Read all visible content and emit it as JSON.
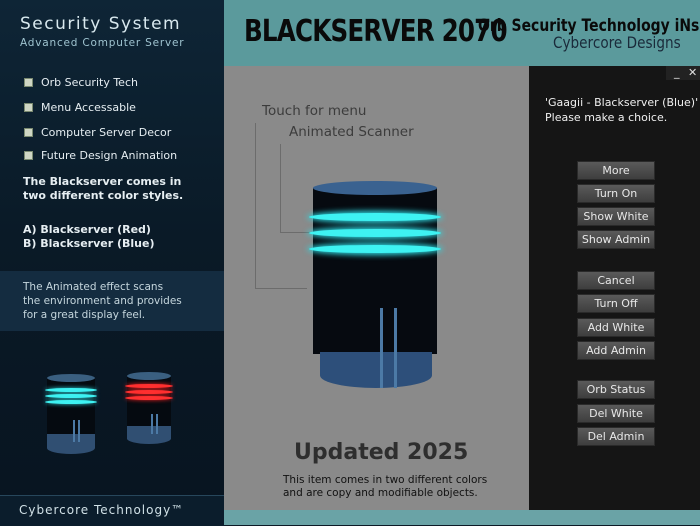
{
  "sidebar": {
    "title": "Security System",
    "subtitle": "Advanced Computer Server",
    "features": [
      "Orb Security Tech",
      "Menu Accessable",
      "Computer Server Decor",
      "Future Design Animation"
    ],
    "styles_intro_line1": "The Blackserver comes in",
    "styles_intro_line2": "two different color styles.",
    "style_a": "A) Blackserver  (Red)",
    "style_b": "B) Blackserver  (Blue)",
    "effect_line1": "The Animated effect scans",
    "effect_line2": "the environment and provides",
    "effect_line3": "for a great display feel.",
    "footer": "Cybercore Technology™"
  },
  "header": {
    "brand": "BLACKSERVER",
    "year": "2070",
    "tagline": "Orb Security Technology iNside",
    "designer": "Cybercore Designs"
  },
  "main": {
    "label_menu": "Touch for menu",
    "label_scanner": "Animated Scanner",
    "updated": "Updated 2025",
    "desc_line1": "This item comes in two different colors",
    "desc_line2": "and are copy and modifiable objects."
  },
  "dialog": {
    "minimize": "_",
    "close": "✕",
    "line1": "'Gaagii - Blackserver (Blue)'",
    "line2": "Please make a choice.",
    "buttons": [
      "More",
      "Turn On",
      "Show White",
      "Show Admin",
      "Cancel",
      "Turn Off",
      "Add White",
      "Add Admin",
      "Orb Status",
      "Del White",
      "Del Admin"
    ]
  },
  "colors": {
    "accent_teal": "#5b9a9c",
    "scanner_blue": "#3ef2f2",
    "scanner_red": "#ff3030"
  }
}
